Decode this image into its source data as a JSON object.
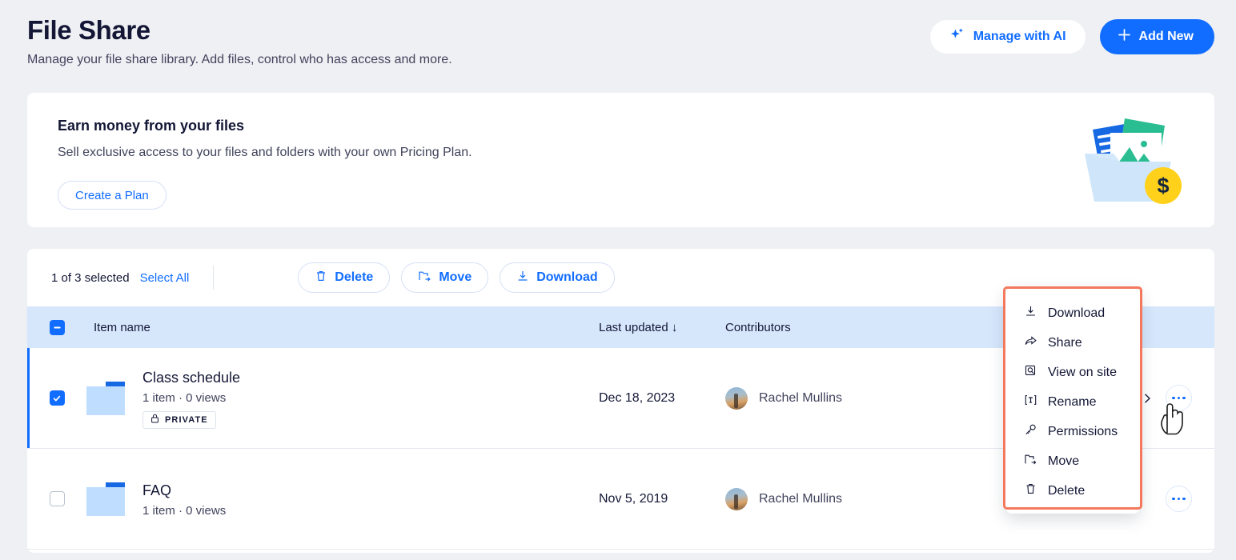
{
  "header": {
    "title": "File Share",
    "subtitle": "Manage your file share library. Add files, control who has access and more.",
    "manage_ai_label": "Manage with AI",
    "add_new_label": "Add New"
  },
  "promo": {
    "title": "Earn money from your files",
    "text": "Sell exclusive access to your files and folders with your own Pricing Plan.",
    "cta_label": "Create a Plan"
  },
  "toolbar": {
    "selection_text": "1 of 3 selected",
    "select_all_label": "Select All",
    "delete_label": "Delete",
    "move_label": "Move",
    "download_label": "Download"
  },
  "table": {
    "columns": {
      "item_name": "Item name",
      "last_updated": "Last updated ↓",
      "contributors": "Contributors"
    },
    "rows": [
      {
        "name": "Class schedule",
        "meta": "1 item · 0 views",
        "badge": "PRIVATE",
        "date": "Dec 18, 2023",
        "contributor": "Rachel Mullins",
        "selected": true
      },
      {
        "name": "FAQ",
        "meta": "1 item · 0 views",
        "badge": "",
        "date": "Nov 5, 2019",
        "contributor": "Rachel Mullins",
        "selected": false
      }
    ]
  },
  "context_menu": {
    "items": [
      {
        "label": "Download",
        "icon": "download-icon"
      },
      {
        "label": "Share",
        "icon": "share-icon"
      },
      {
        "label": "View on site",
        "icon": "view-on-site-icon"
      },
      {
        "label": "Rename",
        "icon": "rename-icon"
      },
      {
        "label": "Permissions",
        "icon": "permissions-icon"
      },
      {
        "label": "Move",
        "icon": "move-icon"
      },
      {
        "label": "Delete",
        "icon": "delete-icon"
      }
    ],
    "highlight_color": "#F4785C"
  },
  "colors": {
    "accent": "#116DFF",
    "page_bg": "#EFF0F4",
    "header_row_bg": "#D6E6FB",
    "text_dark": "#131735"
  }
}
